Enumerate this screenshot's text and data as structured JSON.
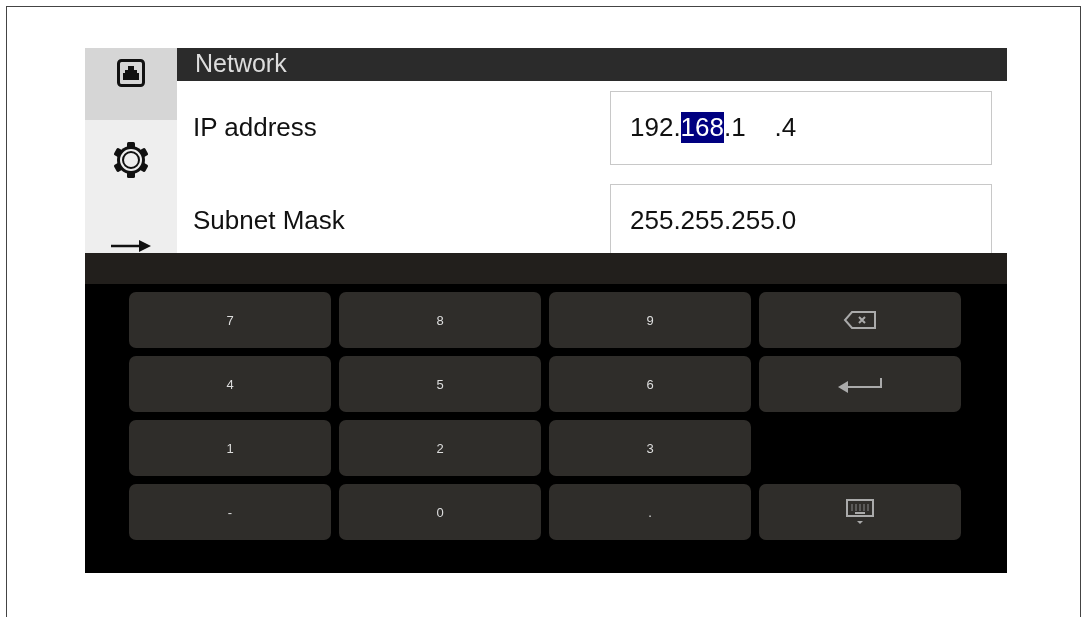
{
  "sidebar": {
    "items": [
      {
        "kind": "network",
        "selected": true
      },
      {
        "kind": "settings",
        "selected": false
      },
      {
        "kind": "arrow",
        "selected": false
      }
    ]
  },
  "header": {
    "title": "Network"
  },
  "fields": [
    {
      "label": "IP address",
      "segments": [
        {
          "text": "192.",
          "selected": false
        },
        {
          "text": "168",
          "selected": true
        },
        {
          "text": ".1    .4",
          "selected": false
        }
      ]
    },
    {
      "label": "Subnet Mask",
      "segments": [
        {
          "text": "255.255.255.0",
          "selected": false
        }
      ]
    }
  ],
  "keyboard": {
    "keys": [
      {
        "kind": "text",
        "label": "7"
      },
      {
        "kind": "text",
        "label": "8"
      },
      {
        "kind": "text",
        "label": "9"
      },
      {
        "kind": "backspace"
      },
      {
        "kind": "text",
        "label": "4"
      },
      {
        "kind": "text",
        "label": "5"
      },
      {
        "kind": "text",
        "label": "6"
      },
      {
        "kind": "enter"
      },
      {
        "kind": "text",
        "label": "1"
      },
      {
        "kind": "text",
        "label": "2"
      },
      {
        "kind": "text",
        "label": "3"
      },
      {
        "kind": "empty"
      },
      {
        "kind": "text",
        "label": "-"
      },
      {
        "kind": "text",
        "label": "0"
      },
      {
        "kind": "text",
        "label": "."
      },
      {
        "kind": "hide"
      }
    ]
  }
}
